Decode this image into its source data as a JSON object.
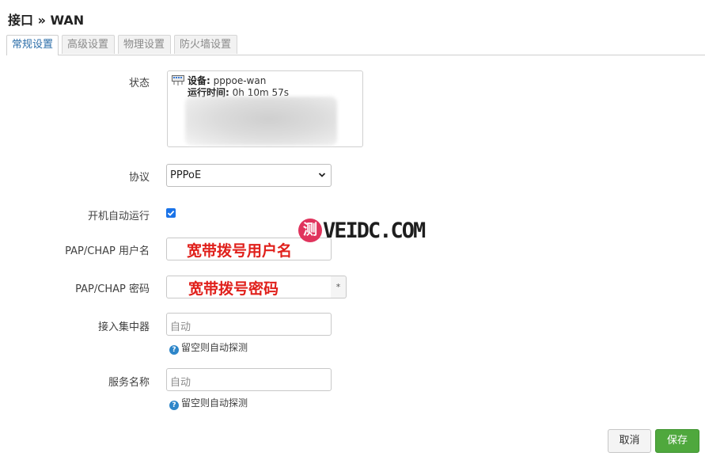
{
  "page": {
    "title": "接口 » WAN"
  },
  "tabs": [
    {
      "label": "常规设置",
      "active": true
    },
    {
      "label": "高级设置",
      "active": false
    },
    {
      "label": "物理设置",
      "active": false
    },
    {
      "label": "防火墙设置",
      "active": false
    }
  ],
  "status": {
    "label": "状态",
    "device_key": "设备:",
    "device_value": "pppoe-wan",
    "uptime_key": "运行时间:",
    "uptime_value": "0h 10m 57s"
  },
  "protocol": {
    "label": "协议",
    "selected": "PPPoE"
  },
  "autostart": {
    "label": "开机自动运行",
    "checked": true
  },
  "username": {
    "label": "PAP/CHAP 用户名",
    "overlay": "宽带拨号用户名"
  },
  "password": {
    "label": "PAP/CHAP 密码",
    "overlay": "宽带拨号密码",
    "toggle": "*"
  },
  "concentrator": {
    "label": "接入集中器",
    "placeholder": "自动",
    "hint": "留空则自动探测"
  },
  "service": {
    "label": "服务名称",
    "placeholder": "自动",
    "hint": "留空则自动探测"
  },
  "watermark": {
    "badge": "测",
    "text": "VEIDC.COM"
  },
  "buttons": {
    "cancel": "取消",
    "save": "保存"
  },
  "colors": {
    "accent": "#2b6da8",
    "save": "#4fa83d",
    "overlay_red": "#e0201b",
    "checkbox": "#1a73e8"
  }
}
